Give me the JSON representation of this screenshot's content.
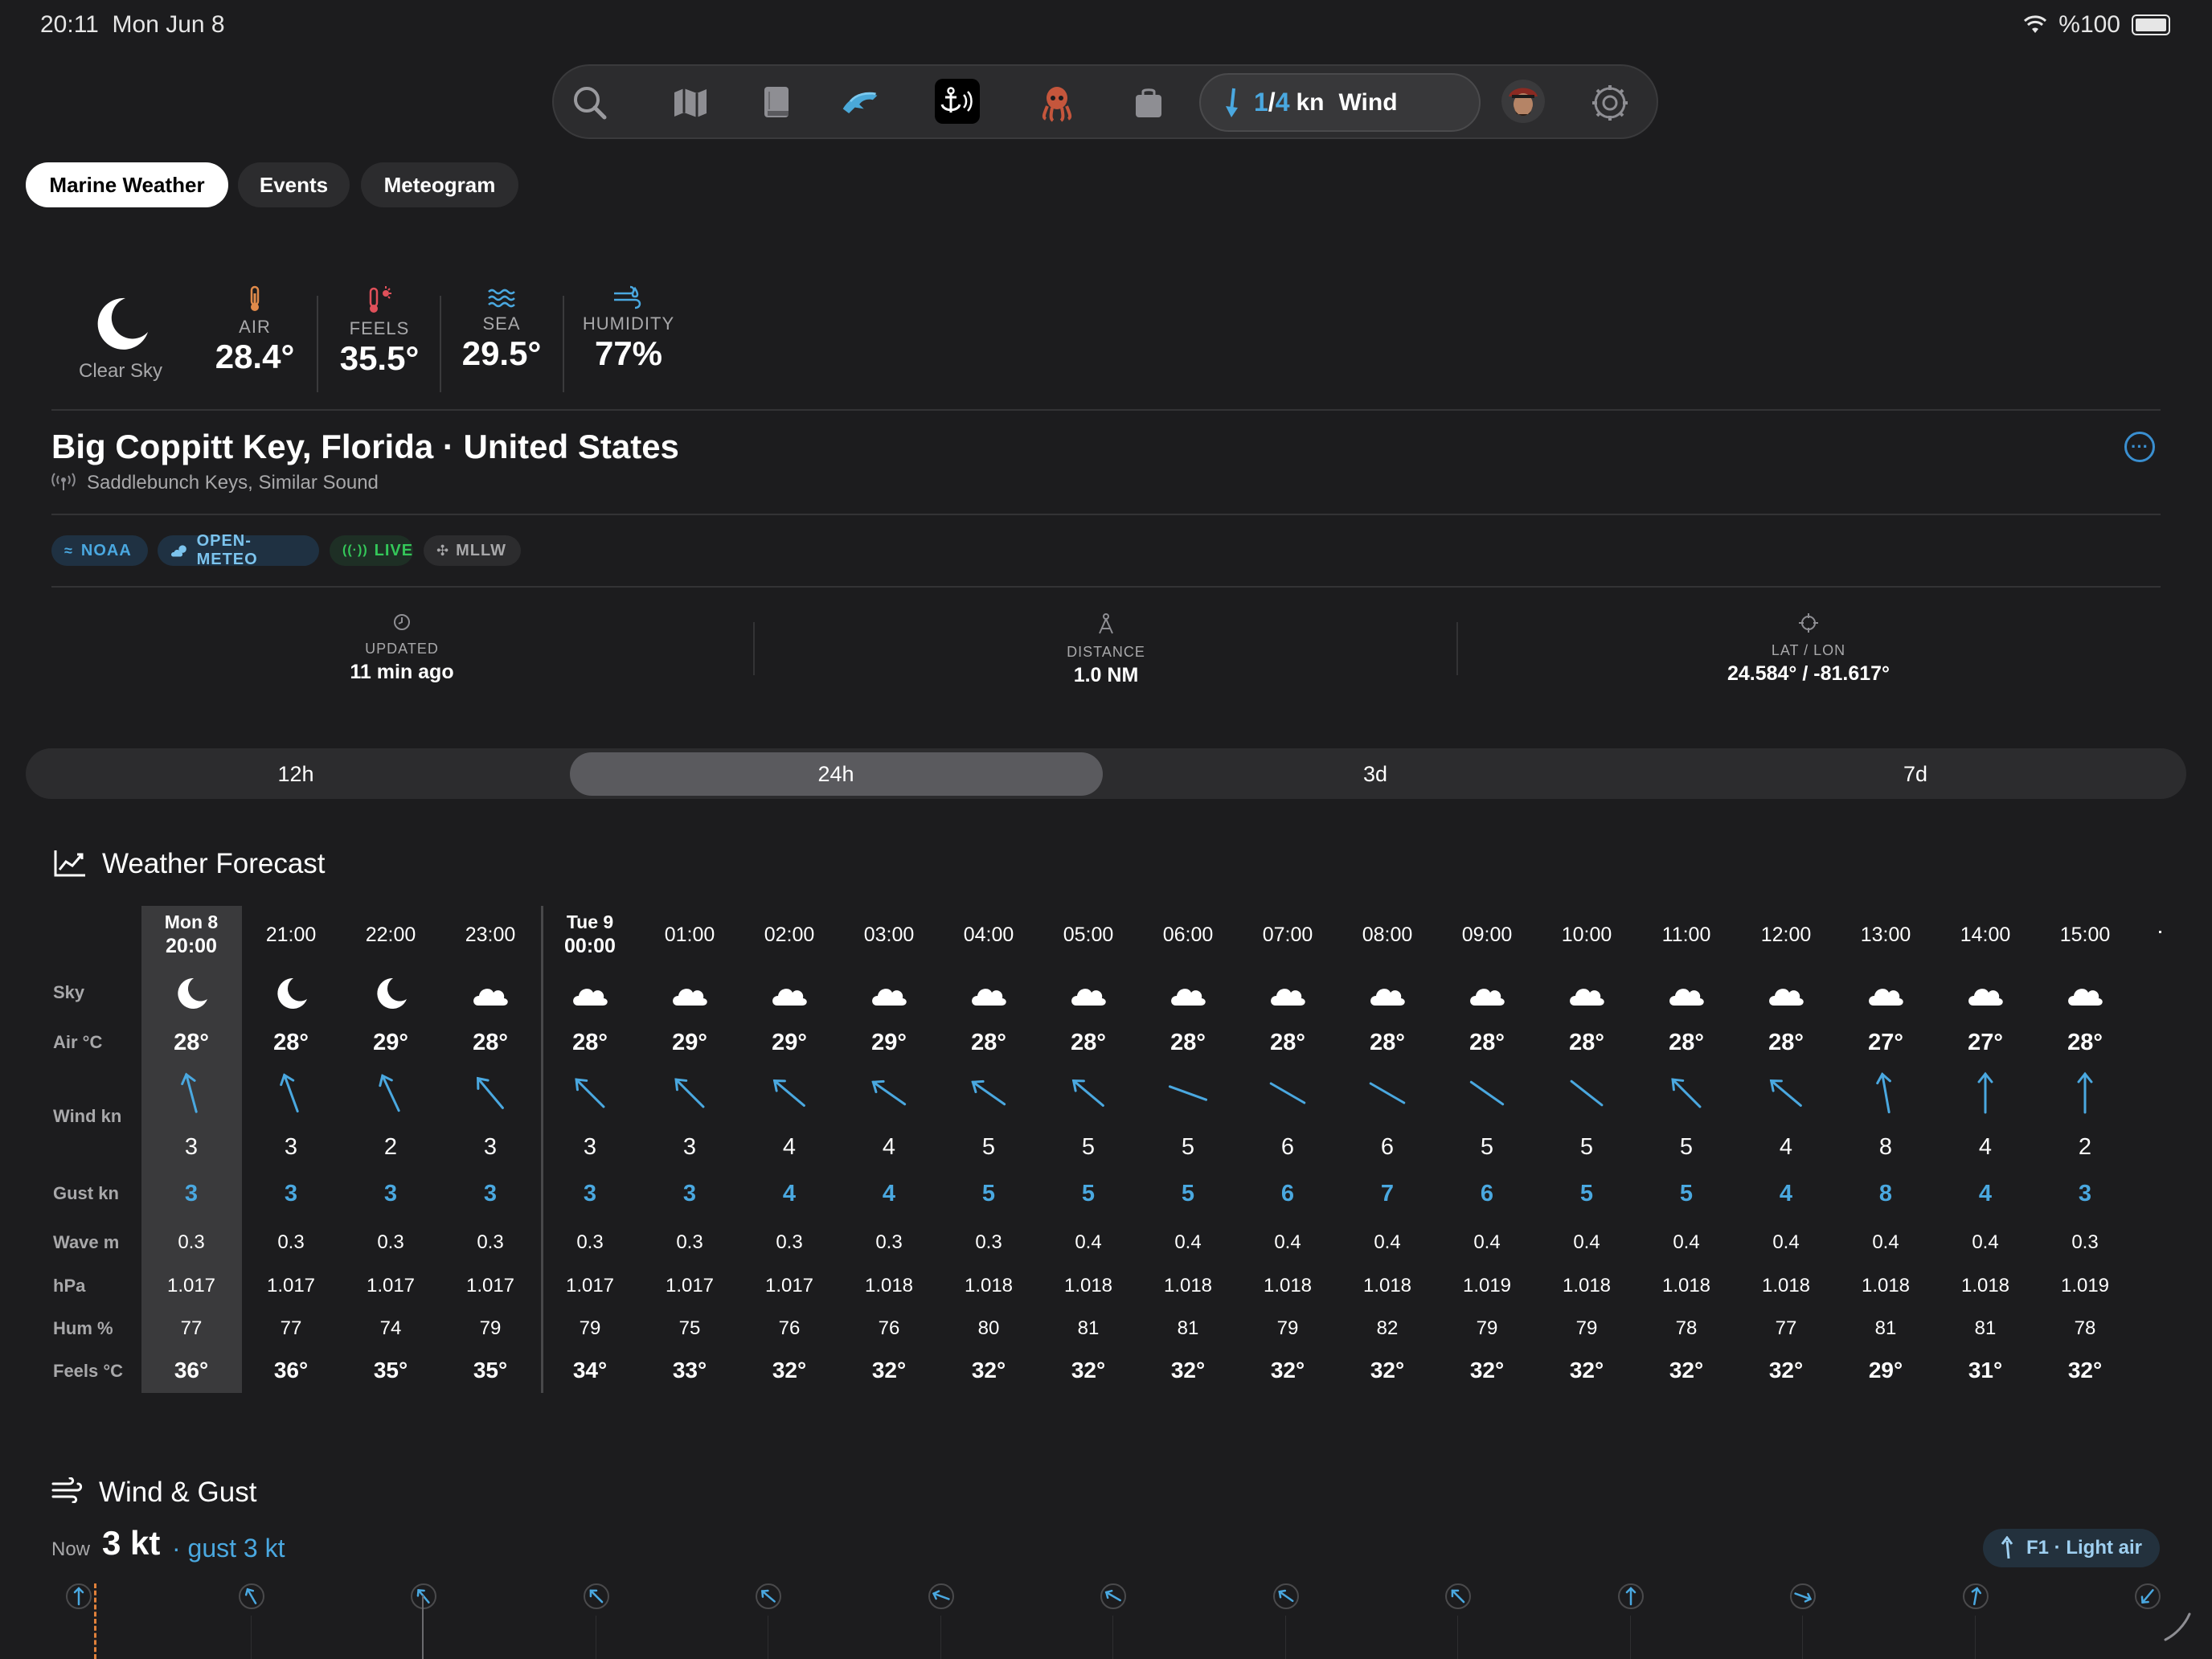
{
  "status_bar": {
    "time": "20:11",
    "date": "Mon Jun 8",
    "battery": "%100"
  },
  "toolbar": {
    "icons": [
      "search-icon",
      "map-icon",
      "logbook-icon",
      "dolphin-icon",
      "anchor-alarm-icon",
      "octopus-icon",
      "bag-icon",
      "avatar",
      "settings-icon"
    ],
    "wind_current": "1",
    "wind_gust": "4",
    "wind_unit": "kn",
    "wind_label": "Wind"
  },
  "tabs": [
    {
      "label": "Marine Weather",
      "active": true
    },
    {
      "label": "Events",
      "active": false
    },
    {
      "label": "Meteogram",
      "active": false
    }
  ],
  "current": {
    "sky": "Clear Sky",
    "air_label": "AIR",
    "air": "28.4°",
    "feels_label": "FEELS",
    "feels": "35.5°",
    "sea_label": "SEA",
    "sea": "29.5°",
    "humidity_label": "HUMIDITY",
    "humidity": "77%"
  },
  "location": {
    "title": "Big Coppitt Key, Florida · United States",
    "station": "Saddlebunch Keys, Similar Sound"
  },
  "badges": [
    "NOAA",
    "OPEN-METEO",
    "LIVE",
    "MLLW"
  ],
  "meta": [
    {
      "label": "UPDATED",
      "value": "11 min ago"
    },
    {
      "label": "DISTANCE",
      "value": "1.0 NM"
    },
    {
      "label": "LAT / LON",
      "value": "24.584° / -81.617°"
    }
  ],
  "ranges": [
    {
      "label": "12h",
      "active": false
    },
    {
      "label": "24h",
      "active": true
    },
    {
      "label": "3d",
      "active": false
    },
    {
      "label": "7d",
      "active": false
    }
  ],
  "forecast": {
    "title": "Weather Forecast",
    "row_labels": [
      "Sky",
      "Air °C",
      "Wind kn",
      "Gust kn",
      "Wave m",
      "hPa",
      "Hum %",
      "Feels °C"
    ],
    "columns": [
      {
        "day": "Mon 8",
        "time": "20:00",
        "sky": "moon",
        "air": "28°",
        "wind_dir": 345,
        "wind": "3",
        "gust": "3",
        "wave": "0.3",
        "hpa": "1.017",
        "hum": "77",
        "feels": "36°"
      },
      {
        "day": "",
        "time": "21:00",
        "sky": "moon",
        "air": "28°",
        "wind_dir": 340,
        "wind": "3",
        "gust": "3",
        "wave": "0.3",
        "hpa": "1.017",
        "hum": "77",
        "feels": "36°"
      },
      {
        "day": "",
        "time": "22:00",
        "sky": "moon",
        "air": "29°",
        "wind_dir": 335,
        "wind": "2",
        "gust": "3",
        "wave": "0.3",
        "hpa": "1.017",
        "hum": "74",
        "feels": "35°"
      },
      {
        "day": "",
        "time": "23:00",
        "sky": "cloud",
        "air": "28°",
        "wind_dir": 320,
        "wind": "3",
        "gust": "3",
        "wave": "0.3",
        "hpa": "1.017",
        "hum": "79",
        "feels": "35°"
      },
      {
        "day": "Tue 9",
        "time": "00:00",
        "sky": "cloud",
        "air": "28°",
        "wind_dir": 315,
        "wind": "3",
        "gust": "3",
        "wave": "0.3",
        "hpa": "1.017",
        "hum": "79",
        "feels": "34°"
      },
      {
        "day": "",
        "time": "01:00",
        "sky": "cloud",
        "air": "29°",
        "wind_dir": 315,
        "wind": "3",
        "gust": "3",
        "wave": "0.3",
        "hpa": "1.017",
        "hum": "75",
        "feels": "33°"
      },
      {
        "day": "",
        "time": "02:00",
        "sky": "cloud",
        "air": "29°",
        "wind_dir": 310,
        "wind": "4",
        "gust": "4",
        "wave": "0.3",
        "hpa": "1.017",
        "hum": "76",
        "feels": "32°"
      },
      {
        "day": "",
        "time": "03:00",
        "sky": "cloud",
        "air": "29°",
        "wind_dir": 305,
        "wind": "4",
        "gust": "4",
        "wave": "0.3",
        "hpa": "1.018",
        "hum": "76",
        "feels": "32°"
      },
      {
        "day": "",
        "time": "04:00",
        "sky": "cloud",
        "air": "28°",
        "wind_dir": 305,
        "wind": "5",
        "gust": "5",
        "wave": "0.3",
        "hpa": "1.018",
        "hum": "80",
        "feels": "32°"
      },
      {
        "day": "",
        "time": "05:00",
        "sky": "cloud",
        "air": "28°",
        "wind_dir": 310,
        "wind": "5",
        "gust": "5",
        "wave": "0.4",
        "hpa": "1.018",
        "hum": "81",
        "feels": "32°"
      },
      {
        "day": "",
        "time": "06:00",
        "sky": "cloud",
        "air": "28°",
        "wind_dir": 290,
        "wind": "5",
        "gust": "5",
        "wave": "0.4",
        "hpa": "1.018",
        "hum": "81",
        "feels": "32°"
      },
      {
        "day": "",
        "time": "07:00",
        "sky": "cloud",
        "air": "28°",
        "wind_dir": 300,
        "wind": "6",
        "gust": "6",
        "wave": "0.4",
        "hpa": "1.018",
        "hum": "79",
        "feels": "32°"
      },
      {
        "day": "",
        "time": "08:00",
        "sky": "cloud",
        "air": "28°",
        "wind_dir": 300,
        "wind": "6",
        "gust": "7",
        "wave": "0.4",
        "hpa": "1.018",
        "hum": "82",
        "feels": "32°"
      },
      {
        "day": "",
        "time": "09:00",
        "sky": "cloud",
        "air": "28°",
        "wind_dir": 305,
        "wind": "5",
        "gust": "6",
        "wave": "0.4",
        "hpa": "1.019",
        "hum": "79",
        "feels": "32°"
      },
      {
        "day": "",
        "time": "10:00",
        "sky": "cloud",
        "air": "28°",
        "wind_dir": 308,
        "wind": "5",
        "gust": "5",
        "wave": "0.4",
        "hpa": "1.018",
        "hum": "79",
        "feels": "32°"
      },
      {
        "day": "",
        "time": "11:00",
        "sky": "cloud",
        "air": "28°",
        "wind_dir": 315,
        "wind": "5",
        "gust": "5",
        "wave": "0.4",
        "hpa": "1.018",
        "hum": "78",
        "feels": "32°"
      },
      {
        "day": "",
        "time": "12:00",
        "sky": "cloud",
        "air": "28°",
        "wind_dir": 310,
        "wind": "4",
        "gust": "4",
        "wave": "0.4",
        "hpa": "1.018",
        "hum": "77",
        "feels": "32°"
      },
      {
        "day": "",
        "time": "13:00",
        "sky": "cloud",
        "air": "27°",
        "wind_dir": 350,
        "wind": "8",
        "gust": "8",
        "wave": "0.4",
        "hpa": "1.018",
        "hum": "81",
        "feels": "29°"
      },
      {
        "day": "",
        "time": "14:00",
        "sky": "cloud",
        "air": "27°",
        "wind_dir": 0,
        "wind": "4",
        "gust": "4",
        "wave": "0.4",
        "hpa": "1.018",
        "hum": "81",
        "feels": "31°"
      },
      {
        "day": "",
        "time": "15:00",
        "sky": "cloud",
        "air": "28°",
        "wind_dir": 0,
        "wind": "2",
        "gust": "3",
        "wave": "0.3",
        "hpa": "1.019",
        "hum": "78",
        "feels": "32°"
      }
    ]
  },
  "wind_gust": {
    "title": "Wind & Gust",
    "now_label": "Now",
    "now_value": "3 kt",
    "gust_text": "· gust 3 kt",
    "beaufort": "F1 · Light air",
    "directions": [
      0,
      330,
      320,
      315,
      310,
      290,
      300,
      305,
      315,
      0,
      110,
      10,
      220
    ]
  },
  "colors": {
    "accent": "#4aa8e0",
    "background": "#1c1c1e",
    "surface": "#2c2c2e",
    "live": "#34c759"
  }
}
